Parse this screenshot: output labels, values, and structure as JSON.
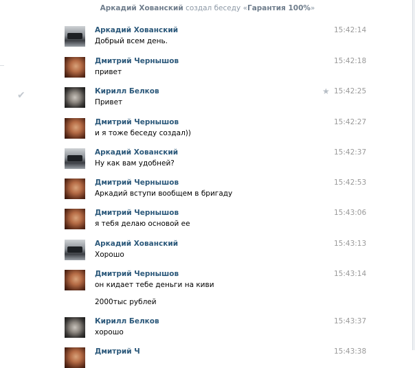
{
  "system_message": {
    "user": "Аркадий Хованский",
    "action": "создал беседу «",
    "chat_name": "Гарантия 100%",
    "close": "»"
  },
  "messages": [
    {
      "author": "Аркадий Хованский",
      "avatar": "ark",
      "time": "15:42:14",
      "lines": [
        "Добрый всем день."
      ]
    },
    {
      "author": "Дмитрий Чернышов",
      "avatar": "dmi",
      "time": "15:42:18",
      "lines": [
        "привет"
      ]
    },
    {
      "author": "Кирилл Белков",
      "avatar": "kir",
      "time": "15:42:25",
      "lines": [
        "Привет"
      ],
      "starred": true,
      "selected": true
    },
    {
      "author": "Дмитрий Чернышов",
      "avatar": "dmi",
      "time": "15:42:27",
      "lines": [
        "и я тоже беседу создал))"
      ]
    },
    {
      "author": "Аркадий Хованский",
      "avatar": "ark",
      "time": "15:42:37",
      "lines": [
        "Ну как вам удобней?"
      ]
    },
    {
      "author": "Дмитрий Чернышов",
      "avatar": "dmi",
      "time": "15:42:53",
      "lines": [
        "Аркадий вступи вообщем в бригаду"
      ]
    },
    {
      "author": "Дмитрий Чернышов",
      "avatar": "dmi",
      "time": "15:43:06",
      "lines": [
        "я тебя делаю основой ее"
      ]
    },
    {
      "author": "Аркадий Хованский",
      "avatar": "ark",
      "time": "15:43:13",
      "lines": [
        "Хорошо"
      ]
    },
    {
      "author": "Дмитрий Чернышов",
      "avatar": "dmi",
      "time": "15:43:14",
      "lines": [
        "он кидает тебе деньги на киви",
        "2000тыс рублей"
      ]
    },
    {
      "author": "Кирилл Белков",
      "avatar": "kir",
      "time": "15:43:37",
      "lines": [
        "хорошо"
      ]
    },
    {
      "author": "Дмитрий Ч",
      "avatar": "dmi",
      "time": "15:43:38",
      "lines": []
    }
  ],
  "icons": {
    "star": "star-icon",
    "check": "check-icon"
  },
  "colors": {
    "author": "#2b587a",
    "time": "#999999",
    "system": "#8d99a6"
  }
}
